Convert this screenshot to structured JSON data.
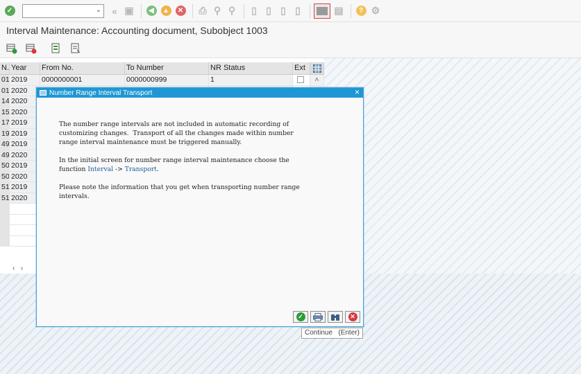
{
  "window_title": "Interval Maintenance: Accounting document, Subobject 1003",
  "command_field": {
    "value": ""
  },
  "toolbar_icons": [
    "enter-icon",
    "back-icon",
    "exit-icon",
    "cancel-icon",
    "print-icon",
    "find-icon",
    "find-next-icon",
    "first-page-icon",
    "prev-page-icon",
    "next-page-icon",
    "last-page-icon",
    "layout-icon",
    "help-icon",
    "settings-icon"
  ],
  "app_toolbar_icons": [
    "insert-interval-icon",
    "delete-interval-icon",
    "select-icon",
    "detail-icon"
  ],
  "grid": {
    "headers": [
      "N..",
      "Year",
      "From No.",
      "To Number",
      "NR Status",
      "Ext"
    ],
    "rows": [
      {
        "n": "01",
        "year": "2019",
        "from": "0000000001",
        "to": "0000000999",
        "status": "1"
      },
      {
        "n": "01",
        "year": "2020",
        "from": "",
        "to": "",
        "status": ""
      },
      {
        "n": "14",
        "year": "2020",
        "from": "",
        "to": "",
        "status": ""
      },
      {
        "n": "15",
        "year": "2020",
        "from": "",
        "to": "",
        "status": ""
      },
      {
        "n": "17",
        "year": "2019",
        "from": "",
        "to": "",
        "status": ""
      },
      {
        "n": "19",
        "year": "2019",
        "from": "",
        "to": "",
        "status": ""
      },
      {
        "n": "49",
        "year": "2019",
        "from": "",
        "to": "",
        "status": ""
      },
      {
        "n": "49",
        "year": "2020",
        "from": "",
        "to": "",
        "status": ""
      },
      {
        "n": "50",
        "year": "2019",
        "from": "",
        "to": "",
        "status": ""
      },
      {
        "n": "50",
        "year": "2020",
        "from": "",
        "to": "",
        "status": ""
      },
      {
        "n": "51",
        "year": "2019",
        "from": "",
        "to": "",
        "status": ""
      },
      {
        "n": "51",
        "year": "2020",
        "from": "",
        "to": "",
        "status": ""
      },
      {
        "n": "",
        "year": "",
        "from": "",
        "to": "",
        "status": ""
      },
      {
        "n": "",
        "year": "",
        "from": "",
        "to": "",
        "status": ""
      },
      {
        "n": "",
        "year": "",
        "from": "",
        "to": "",
        "status": ""
      },
      {
        "n": "",
        "year": "",
        "from": "",
        "to": "",
        "status": ""
      }
    ]
  },
  "dialog": {
    "title": "Number Range Interval Transport",
    "para1": "The number range intervals are not included in automatic recording of\ncustomizing changes.  Transport of all the changes made within number\nrange interval maintenance must be triggered manually.",
    "para2_a": "In the initial screen for number range interval maintenance choose the\nfunction ",
    "para2_link1": "Interval",
    "para2_arrow": " -> ",
    "para2_link2": "Transport",
    "para2_end": ".",
    "para3": "Please note the information that you get when transporting number range\nintervals.",
    "buttons": [
      "continue-icon",
      "print-icon",
      "find-icon",
      "cancel-icon"
    ],
    "tooltip": "Continue   (Enter)"
  },
  "colors": {
    "accent": "#1e97d4",
    "ok_green": "#2e9a3a",
    "cancel_red": "#d9363e",
    "orange": "#f0a830"
  }
}
